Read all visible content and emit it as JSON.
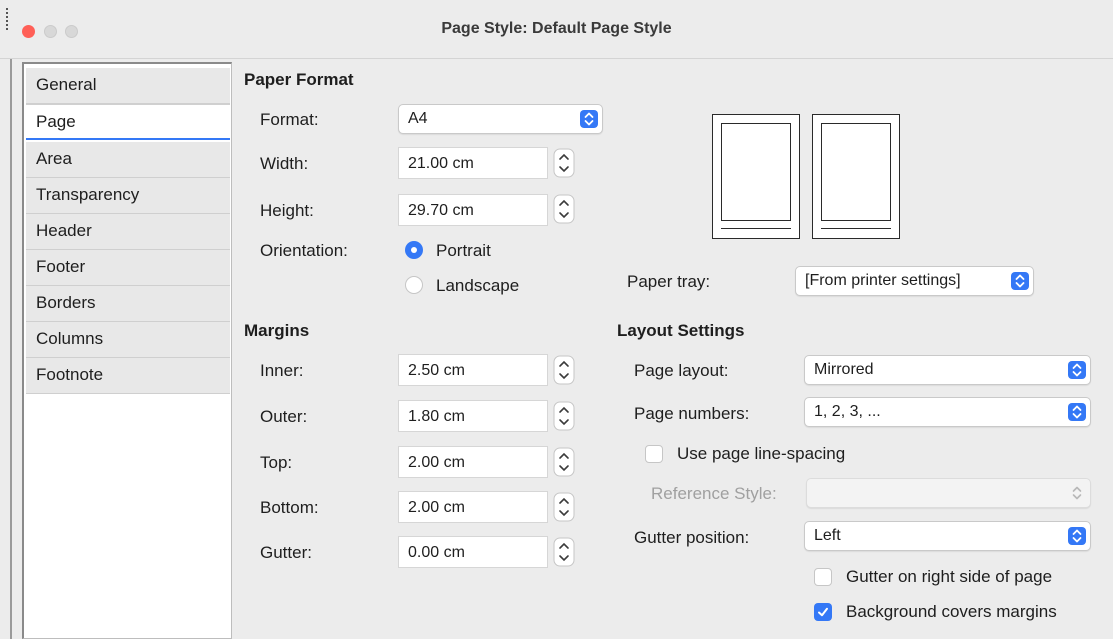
{
  "window": {
    "title": "Page Style: Default Page Style"
  },
  "sidebar": {
    "tabs": [
      {
        "label": "General"
      },
      {
        "label": "Page",
        "active": true
      },
      {
        "label": "Area"
      },
      {
        "label": "Transparency"
      },
      {
        "label": "Header"
      },
      {
        "label": "Footer"
      },
      {
        "label": "Borders"
      },
      {
        "label": "Columns"
      },
      {
        "label": "Footnote"
      }
    ]
  },
  "paper_format": {
    "heading": "Paper Format",
    "format": {
      "label": "Format:",
      "value": "A4"
    },
    "width": {
      "label": "Width:",
      "value": "21.00 cm"
    },
    "height": {
      "label": "Height:",
      "value": "29.70 cm"
    },
    "orientation": {
      "label": "Orientation:",
      "options": [
        "Portrait",
        "Landscape"
      ],
      "selected": "Portrait"
    },
    "paper_tray": {
      "label": "Paper tray:",
      "value": "[From printer settings]"
    }
  },
  "margins": {
    "heading": "Margins",
    "inner": {
      "label": "Inner:",
      "value": "2.50 cm"
    },
    "outer": {
      "label": "Outer:",
      "value": "1.80 cm"
    },
    "top": {
      "label": "Top:",
      "value": "2.00 cm"
    },
    "bottom": {
      "label": "Bottom:",
      "value": "2.00 cm"
    },
    "gutter": {
      "label": "Gutter:",
      "value": "0.00 cm"
    }
  },
  "layout_settings": {
    "heading": "Layout Settings",
    "page_layout": {
      "label": "Page layout:",
      "value": "Mirrored"
    },
    "page_numbers": {
      "label": "Page numbers:",
      "value": "1, 2, 3, ..."
    },
    "use_line_spacing": {
      "label": "Use page line-spacing",
      "checked": false
    },
    "reference_style": {
      "label": "Reference Style:",
      "value": "",
      "disabled": true
    },
    "gutter_position": {
      "label": "Gutter position:",
      "value": "Left"
    },
    "gutter_right": {
      "label": "Gutter on right side of page",
      "checked": false
    },
    "background_covers": {
      "label": "Background covers margins",
      "checked": true
    }
  },
  "colors": {
    "accent": "#3478f6",
    "close": "#ff5f57",
    "inactive_dot": "#d8d8d8"
  },
  "icons": [
    "close-dot",
    "chevron-updown-icon",
    "stepper-icon",
    "checkmark-icon"
  ]
}
